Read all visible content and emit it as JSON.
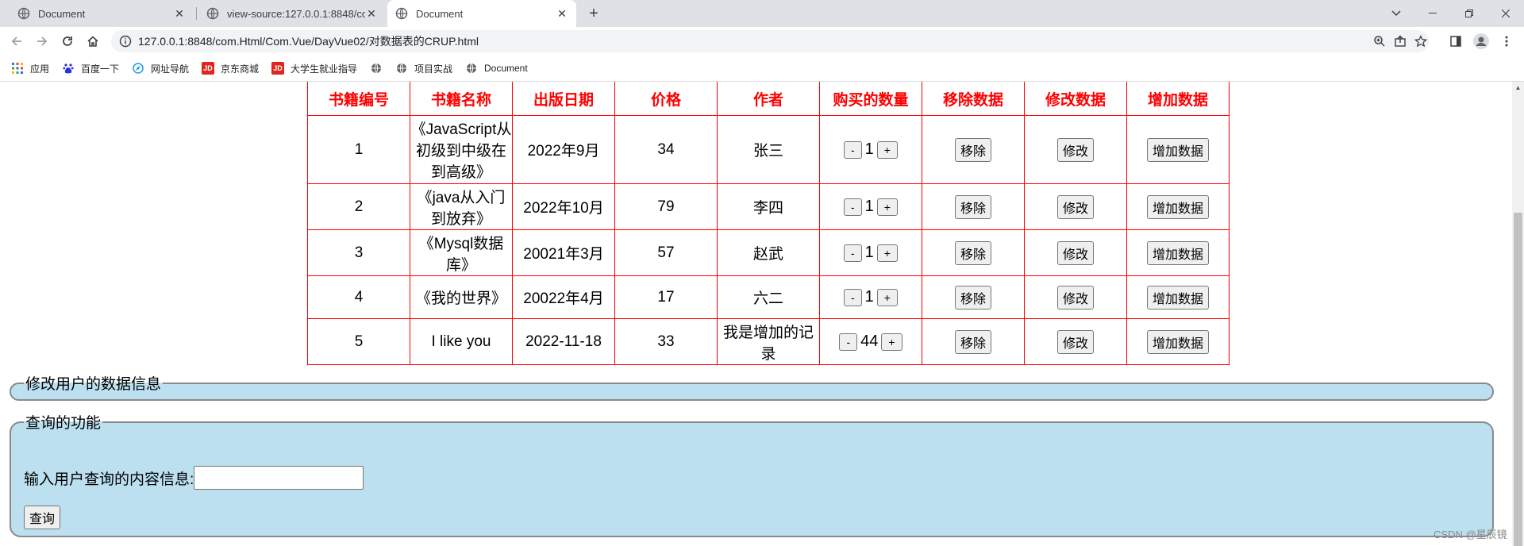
{
  "browser": {
    "tabs": [
      {
        "title": "Document",
        "active": false
      },
      {
        "title": "view-source:127.0.0.1:8848/co",
        "active": false
      },
      {
        "title": "Document",
        "active": true
      }
    ],
    "new_tab": "+",
    "url": "127.0.0.1:8848/com.Html/Com.Vue/DayVue02/对数据表的CRUP.html",
    "bookmarks": [
      {
        "label": "应用",
        "icon": "apps-grid-icon"
      },
      {
        "label": "百度一下",
        "icon": "baidu-icon"
      },
      {
        "label": "网址导航",
        "icon": "navigation-icon"
      },
      {
        "label": "京东商城",
        "icon": "jd-icon"
      },
      {
        "label": "大学生就业指导",
        "icon": "jd-icon"
      },
      {
        "label": "",
        "icon": "globe-icon"
      },
      {
        "label": "项目实战",
        "icon": "globe-icon"
      },
      {
        "label": "Document",
        "icon": "globe-icon"
      }
    ]
  },
  "table": {
    "headers": [
      "书籍编号",
      "书籍名称",
      "出版日期",
      "价格",
      "作者",
      "购买的数量",
      "移除数据",
      "修改数据",
      "增加数据"
    ],
    "rows": [
      {
        "id": "1",
        "name": "《JavaScript从初级到中级在到高级》",
        "date": "2022年9月",
        "price": "34",
        "author": "张三",
        "qty": "1"
      },
      {
        "id": "2",
        "name": "《java从入门到放弃》",
        "date": "2022年10月",
        "price": "79",
        "author": "李四",
        "qty": "1"
      },
      {
        "id": "3",
        "name": "《Mysql数据库》",
        "date": "20021年3月",
        "price": "57",
        "author": "赵武",
        "qty": "1"
      },
      {
        "id": "4",
        "name": "《我的世界》",
        "date": "20022年4月",
        "price": "17",
        "author": "六二",
        "qty": "1"
      },
      {
        "id": "5",
        "name": "I like you",
        "date": "2022-11-18",
        "price": "33",
        "author": "我是增加的记录",
        "qty": "44"
      }
    ],
    "minus_label": "-",
    "plus_label": "+",
    "remove_label": "移除",
    "edit_label": "修改",
    "add_label": "增加数据"
  },
  "edit_section": {
    "legend": "修改用户的数据信息"
  },
  "query_section": {
    "legend": "查询的功能",
    "input_label": "输入用户查询的内容信息:",
    "input_value": "",
    "button_label": "查询"
  },
  "watermark": "CSDN @星辰镜"
}
